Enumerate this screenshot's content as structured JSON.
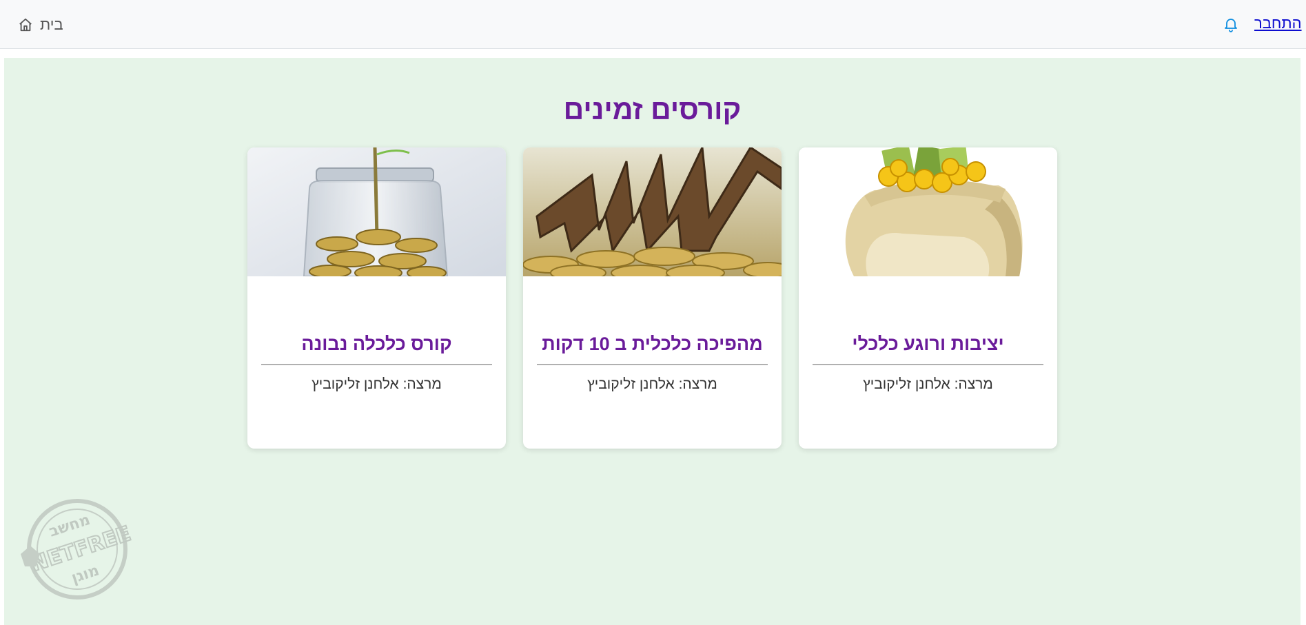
{
  "nav": {
    "home_label": "בית",
    "login_label": "התחבר"
  },
  "main": {
    "title": "קורסים זמינים",
    "courses": [
      {
        "title": "יציבות ורוגע כלכלי",
        "presenter": "מרצה: אלחנן זליקוביץ"
      },
      {
        "title": "מהפיכה כלכלית ב 10 דקות",
        "presenter": "מרצה: אלחנן זליקוביץ"
      },
      {
        "title": "קורס כלכלה נבונה",
        "presenter": "מרצה: אלחנן זליקוביץ"
      }
    ]
  },
  "watermark": {
    "top_text": "מחשב",
    "brand": "NETFREE",
    "bottom_text": "מוגן"
  },
  "colors": {
    "accent_purple": "#6a1b9a",
    "background_green": "#e6f4e8",
    "link_blue": "#0d0dcf",
    "bell_blue": "#0d8de0"
  },
  "icons": [
    "home-icon",
    "bell-icon"
  ]
}
